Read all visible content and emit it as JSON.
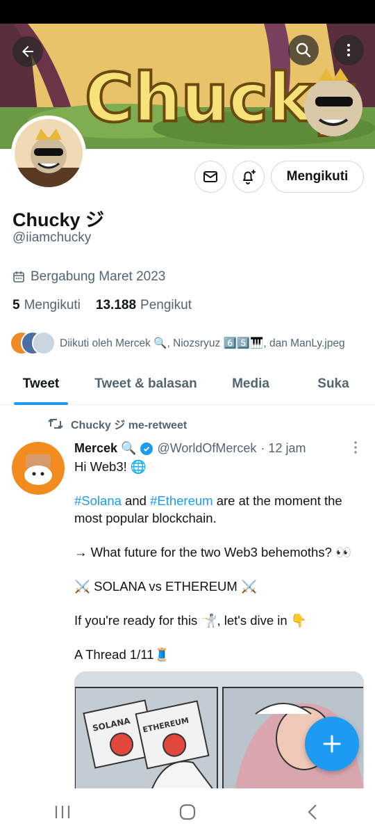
{
  "banner": {
    "title_text": "Chucky"
  },
  "profile": {
    "display_name": "Chucky ジ",
    "handle": "@iiamchucky",
    "joined": "Bergabung Maret 2023",
    "following_count": "5",
    "following_label": "Mengikuti",
    "followers_count": "13.188",
    "followers_label": "Pengikut",
    "followed_by": "Diikuti oleh Mercek 🔍, Niozsryuz 6️⃣5️⃣🎹, dan ManLy.jpeg",
    "follow_button_label": "Mengikuti"
  },
  "tabs": [
    {
      "label": "Tweet",
      "active": true
    },
    {
      "label": "Tweet & balasan",
      "active": false
    },
    {
      "label": "Media",
      "active": false
    },
    {
      "label": "Suka",
      "active": false
    }
  ],
  "tweet": {
    "retweet_label": "Chucky ジ me-retweet",
    "author_name": "Mercek 🔍",
    "author_handle": "@WorldOfMercek",
    "time": "· 12 jam",
    "lines": {
      "l1": "Hi Web3! 🌐",
      "hashtag1": "#Solana",
      "and": " and ",
      "hashtag2": "#Ethereum",
      "l2_rest": " are at the moment the most popular blockchain.",
      "l3": "→ What future for the two Web3 behemoths? 👀",
      "l4": "⚔️ SOLANA vs ETHEREUM ⚔️",
      "l5": "If you're ready for this 🤺, let's dive in 👇",
      "l6": "A Thread 1/11🧵"
    },
    "media_labels": {
      "left_button": "SOLANA",
      "right_button": "ETHEREUM"
    }
  },
  "colors": {
    "accent": "#1d9bf0",
    "muted": "#536471",
    "text": "#0f1419"
  }
}
